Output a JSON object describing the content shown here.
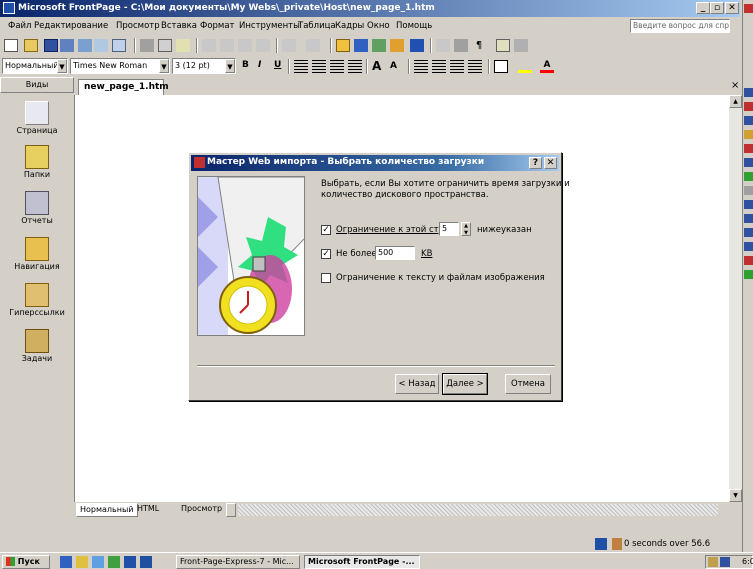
{
  "window": {
    "title": "Microsoft FrontPage - C:\\Мои документы\\My Webs\\_private\\Host\\new_page_1.htm",
    "minimize": "_",
    "restore": "▫",
    "close": "✕"
  },
  "menu": {
    "items": [
      "Файл",
      "Редактирование",
      "Просмотр",
      "Вставка",
      "Формат",
      "Инструменты",
      "Таблица",
      "Кадры",
      "Окно",
      "Помощь"
    ],
    "ask_placeholder": "Введите вопрос для спра"
  },
  "format_toolbar": {
    "style": "Нормальный",
    "font": "Times New Roman",
    "size": "3 (12 pt)",
    "bold": "B",
    "italic": "I",
    "underline": "U"
  },
  "views": {
    "header": "Виды",
    "items": [
      "Страница",
      "Папки",
      "Отчеты",
      "Навигация",
      "Гиперссылки",
      "Задачи"
    ]
  },
  "editor": {
    "tab": "new_page_1.htm",
    "close": "×"
  },
  "bottom_tabs": [
    "Нормальный",
    "HTML",
    "Просмотр"
  ],
  "status": {
    "text": "0 seconds over 56.6"
  },
  "dialog": {
    "title": "Мастер Web импорта - Выбрать количество загрузки",
    "help": "?",
    "close": "✕",
    "description_line1": "Выбрать, если Вы хотите ограничить время загрузки и",
    "description_line2": "количество дискового пространства.",
    "option1_label": "Ограничение к этой стран",
    "option1_value": "5",
    "option1_suffix": "нижеуказан",
    "option1_checked": "✓",
    "option2_label": "Не более",
    "option2_value": "500",
    "option2_unit": "KB",
    "option2_checked": "✓",
    "option3_label": "Ограничение к тексту и файлам изображения",
    "back_button": "< Назад",
    "next_button": "Далее >",
    "cancel_button": "Отмена"
  },
  "taskbar": {
    "start": "Пуск",
    "tasks": [
      "Front-Page-Express-7 - Mic...",
      "Microsoft FrontPage -..."
    ],
    "clock": "6:0"
  },
  "colors": {
    "title_active": "#0a246a",
    "title_gradient_end": "#a6caf0",
    "face": "#d4d0c8"
  }
}
